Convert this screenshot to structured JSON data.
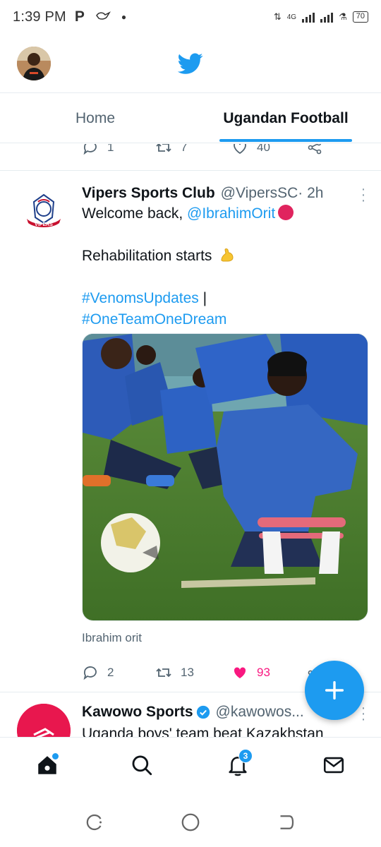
{
  "status_bar": {
    "time": "1:39 PM",
    "left_icons": [
      "parking-icon",
      "bird-notification-icon",
      "dot-icon"
    ],
    "network": "4G",
    "battery": "70"
  },
  "header": {
    "logo": "twitter-bird-icon",
    "avatar": "profile-avatar"
  },
  "tabs": [
    {
      "label": "Home",
      "active": false
    },
    {
      "label": "Ugandan Football",
      "active": true
    }
  ],
  "previous_tweet_actions": {
    "replies": "1",
    "retweets": "7",
    "likes": "40"
  },
  "tweets": [
    {
      "name": "Vipers Sports Club",
      "handle": "@VipersSC",
      "time": " · 2h",
      "text_line1_prefix": "Welcome back, ",
      "text_line1_mention": "@IbrahimOrit",
      "text_line2": "Rehabilitation starts",
      "hashtag1": "#VenomsUpdates",
      "hashtag_sep": " |",
      "hashtag2": "#OneTeamOneDream",
      "media_caption": "Ibrahim orit",
      "replies": "2",
      "retweets": "13",
      "likes": "93"
    },
    {
      "name": "Kawowo Sports",
      "handle": "@kawowos...",
      "text": "Uganda boys' team beat Kazakhstan"
    }
  ],
  "bottom_nav": {
    "items": [
      "home-icon",
      "search-icon",
      "notifications-icon",
      "messages-icon"
    ],
    "notification_count": "3"
  },
  "colors": {
    "accent": "#1d9bf0",
    "like": "#f91880",
    "secondary_text": "#536471"
  }
}
